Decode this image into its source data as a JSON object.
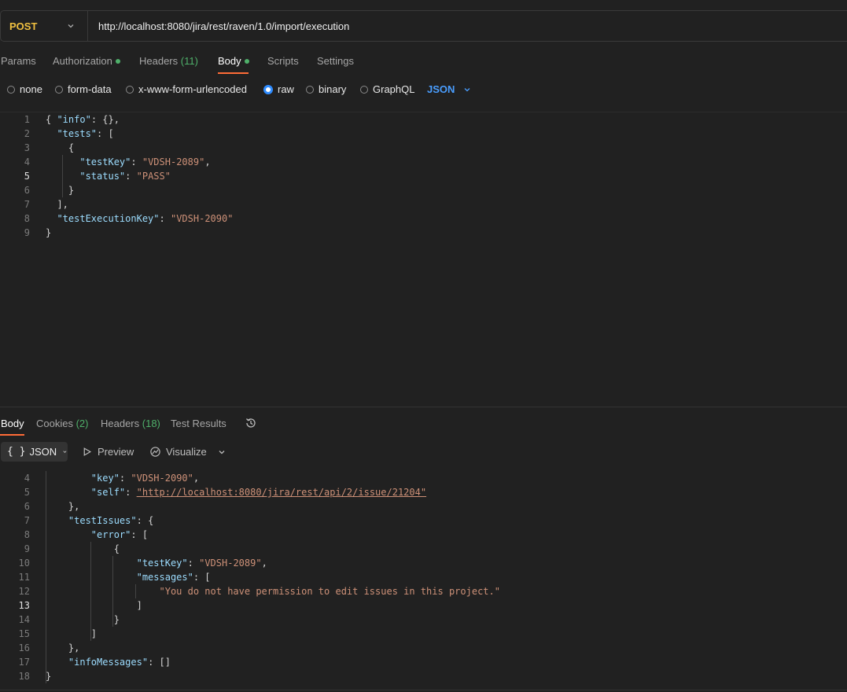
{
  "request": {
    "method": "POST",
    "url": "http://localhost:8080/jira/rest/raven/1.0/import/execution"
  },
  "request_tabs": {
    "params": "Params",
    "authorization": "Authorization",
    "headers": "Headers",
    "headers_count": "(11)",
    "body": "Body",
    "scripts": "Scripts",
    "settings": "Settings"
  },
  "body_types": {
    "none": "none",
    "form_data": "form-data",
    "urlencoded": "x-www-form-urlencoded",
    "raw": "raw",
    "binary": "binary",
    "graphql": "GraphQL",
    "selected": "raw",
    "format": "JSON"
  },
  "request_body_lines": [
    {
      "n": "1",
      "text": "{ \"info\": {},"
    },
    {
      "n": "2",
      "text": "  \"tests\": ["
    },
    {
      "n": "3",
      "text": "    {"
    },
    {
      "n": "4",
      "text": "      \"testKey\": \"VDSH-2089\","
    },
    {
      "n": "5",
      "text": "      \"status\": \"PASS\""
    },
    {
      "n": "6",
      "text": "    }"
    },
    {
      "n": "7",
      "text": "  ],"
    },
    {
      "n": "8",
      "text": "  \"testExecutionKey\": \"VDSH-2090\""
    },
    {
      "n": "9",
      "text": "}"
    }
  ],
  "response_tabs": {
    "body": "Body",
    "cookies": "Cookies",
    "cookies_count": "(2)",
    "headers": "Headers",
    "headers_count": "(18)",
    "test_results": "Test Results"
  },
  "response_toolbar": {
    "format_icon": "{ }",
    "format": "JSON",
    "preview": "Preview",
    "visualize": "Visualize"
  },
  "response_body_lines": [
    {
      "n": "4",
      "text": "        \"key\": \"VDSH-2090\","
    },
    {
      "n": "5",
      "text": "        \"self\": \"http://localhost:8080/jira/rest/api/2/issue/21204\""
    },
    {
      "n": "6",
      "text": "    },"
    },
    {
      "n": "7",
      "text": "    \"testIssues\": {"
    },
    {
      "n": "8",
      "text": "        \"error\": ["
    },
    {
      "n": "9",
      "text": "            {"
    },
    {
      "n": "10",
      "text": "                \"testKey\": \"VDSH-2089\","
    },
    {
      "n": "11",
      "text": "                \"messages\": ["
    },
    {
      "n": "12",
      "text": "                    \"You do not have permission to edit issues in this project.\""
    },
    {
      "n": "13",
      "text": "                ]"
    },
    {
      "n": "14",
      "text": "            }"
    },
    {
      "n": "15",
      "text": "        ]"
    },
    {
      "n": "16",
      "text": "    },"
    },
    {
      "n": "17",
      "text": "    \"infoMessages\": []"
    },
    {
      "n": "18",
      "text": "}"
    }
  ],
  "colors": {
    "method": "#f0c040",
    "accent": "#ff6c37",
    "status_dot": "#4fb06a",
    "json_key": "#9cdcfe",
    "json_string": "#ce9178",
    "link": "#4a9eff"
  }
}
